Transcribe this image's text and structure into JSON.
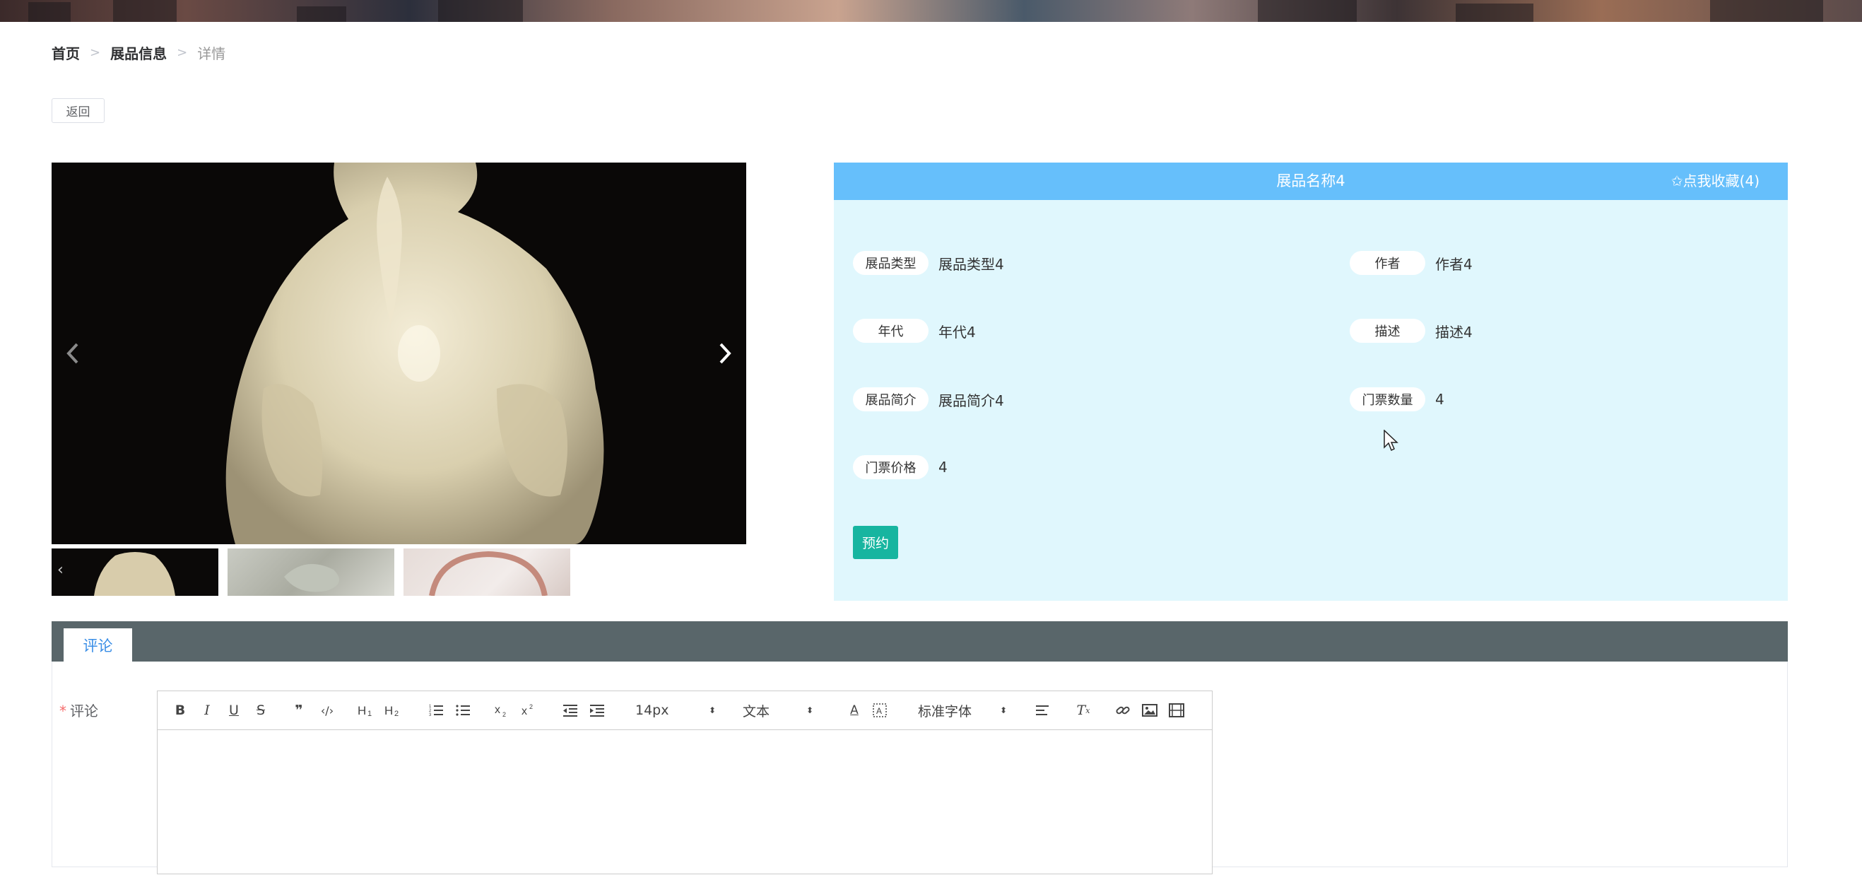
{
  "breadcrumb": {
    "home": "首页",
    "list": "展品信息",
    "current": "详情",
    "separator": ">"
  },
  "back_button": "返回",
  "exhibit": {
    "title": "展品名称4",
    "favorite_label": "✩点我收藏(4)",
    "fields": {
      "type_label": "展品类型",
      "type_value": "展品类型4",
      "author_label": "作者",
      "author_value": "作者4",
      "era_label": "年代",
      "era_value": "年代4",
      "desc_label": "描述",
      "desc_value": "描述4",
      "intro_label": "展品简介",
      "intro_value": "展品简介4",
      "ticket_count_label": "门票数量",
      "ticket_count_value": "4",
      "ticket_price_label": "门票价格",
      "ticket_price_value": "4"
    },
    "book_button": "预约"
  },
  "tabs": {
    "comments": "评论"
  },
  "comment_form": {
    "required_mark": "*",
    "label": "评论",
    "font_size": "14px",
    "text_type": "文本",
    "font_family": "标准字体"
  },
  "colors": {
    "header_blue": "#66bffb",
    "panel_bg": "#e0f7fd",
    "book_button": "#17b5a0",
    "tab_bar": "#59666a",
    "tab_text": "#3a8ee6"
  },
  "icons": [
    "chevron-left-icon",
    "chevron-right-icon",
    "bold-icon",
    "italic-icon",
    "underline-icon",
    "strike-icon",
    "quote-icon",
    "code-icon",
    "h1-icon",
    "h2-icon",
    "ordered-list-icon",
    "bullet-list-icon",
    "subscript-icon",
    "superscript-icon",
    "outdent-icon",
    "indent-icon",
    "font-color-icon",
    "background-color-icon",
    "align-icon",
    "clear-format-icon",
    "link-icon",
    "image-icon",
    "video-icon"
  ]
}
